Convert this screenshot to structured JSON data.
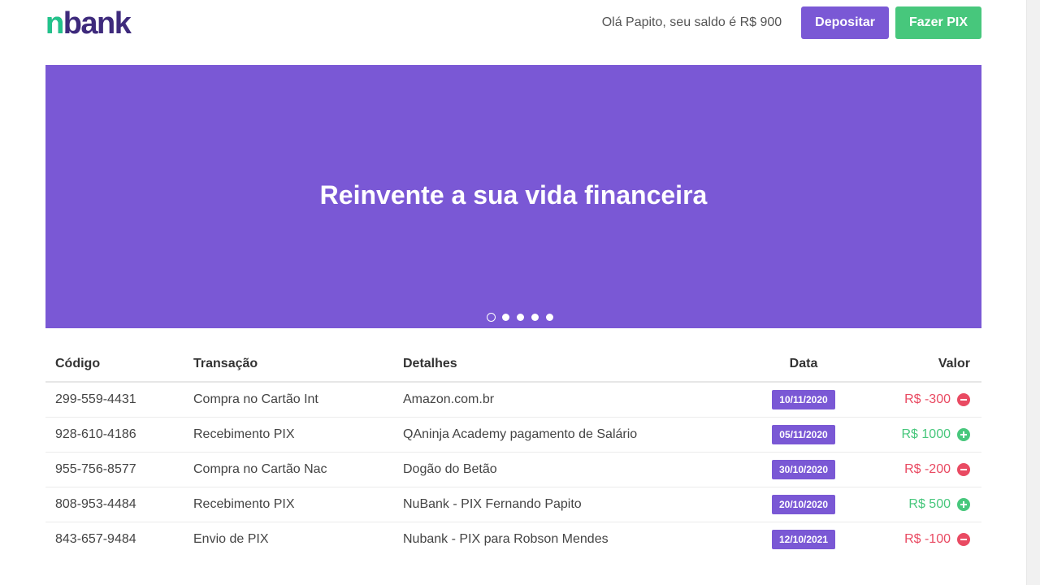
{
  "header": {
    "logo_text": "nbank",
    "greeting": "Olá Papito, seu saldo é R$ 900",
    "deposit_label": "Depositar",
    "pix_label": "Fazer PIX"
  },
  "colors": {
    "brand_purple": "#7a58d5",
    "brand_green": "#47c77c",
    "negative_red": "#e94a62"
  },
  "banner": {
    "title": "Reinvente a sua vida financeira",
    "slides": 5,
    "active_slide": 1
  },
  "table": {
    "columns": {
      "code": "Código",
      "transaction": "Transação",
      "details": "Detalhes",
      "date": "Data",
      "value": "Valor"
    },
    "rows": [
      {
        "code": "299-559-4431",
        "transaction": "Compra no Cartão Int",
        "details": "Amazon.com.br",
        "date": "10/11/2020",
        "value": "R$ -300",
        "type": "negative",
        "icon": "minus-circle-icon"
      },
      {
        "code": "928-610-4186",
        "transaction": "Recebimento PIX",
        "details": "QAninja Academy pagamento de Salário",
        "date": "05/11/2020",
        "value": "R$ 1000",
        "type": "positive",
        "icon": "plus-circle-icon"
      },
      {
        "code": "955-756-8577",
        "transaction": "Compra no Cartão Nac",
        "details": "Dogão do Betão",
        "date": "30/10/2020",
        "value": "R$ -200",
        "type": "negative",
        "icon": "minus-circle-icon"
      },
      {
        "code": "808-953-4484",
        "transaction": "Recebimento PIX",
        "details": "NuBank - PIX Fernando Papito",
        "date": "20/10/2020",
        "value": "R$ 500",
        "type": "positive",
        "icon": "plus-circle-icon"
      },
      {
        "code": "843-657-9484",
        "transaction": "Envio de PIX",
        "details": "Nubank - PIX para Robson Mendes",
        "date": "12/10/2021",
        "value": "R$ -100",
        "type": "negative",
        "icon": "minus-circle-icon"
      }
    ]
  }
}
